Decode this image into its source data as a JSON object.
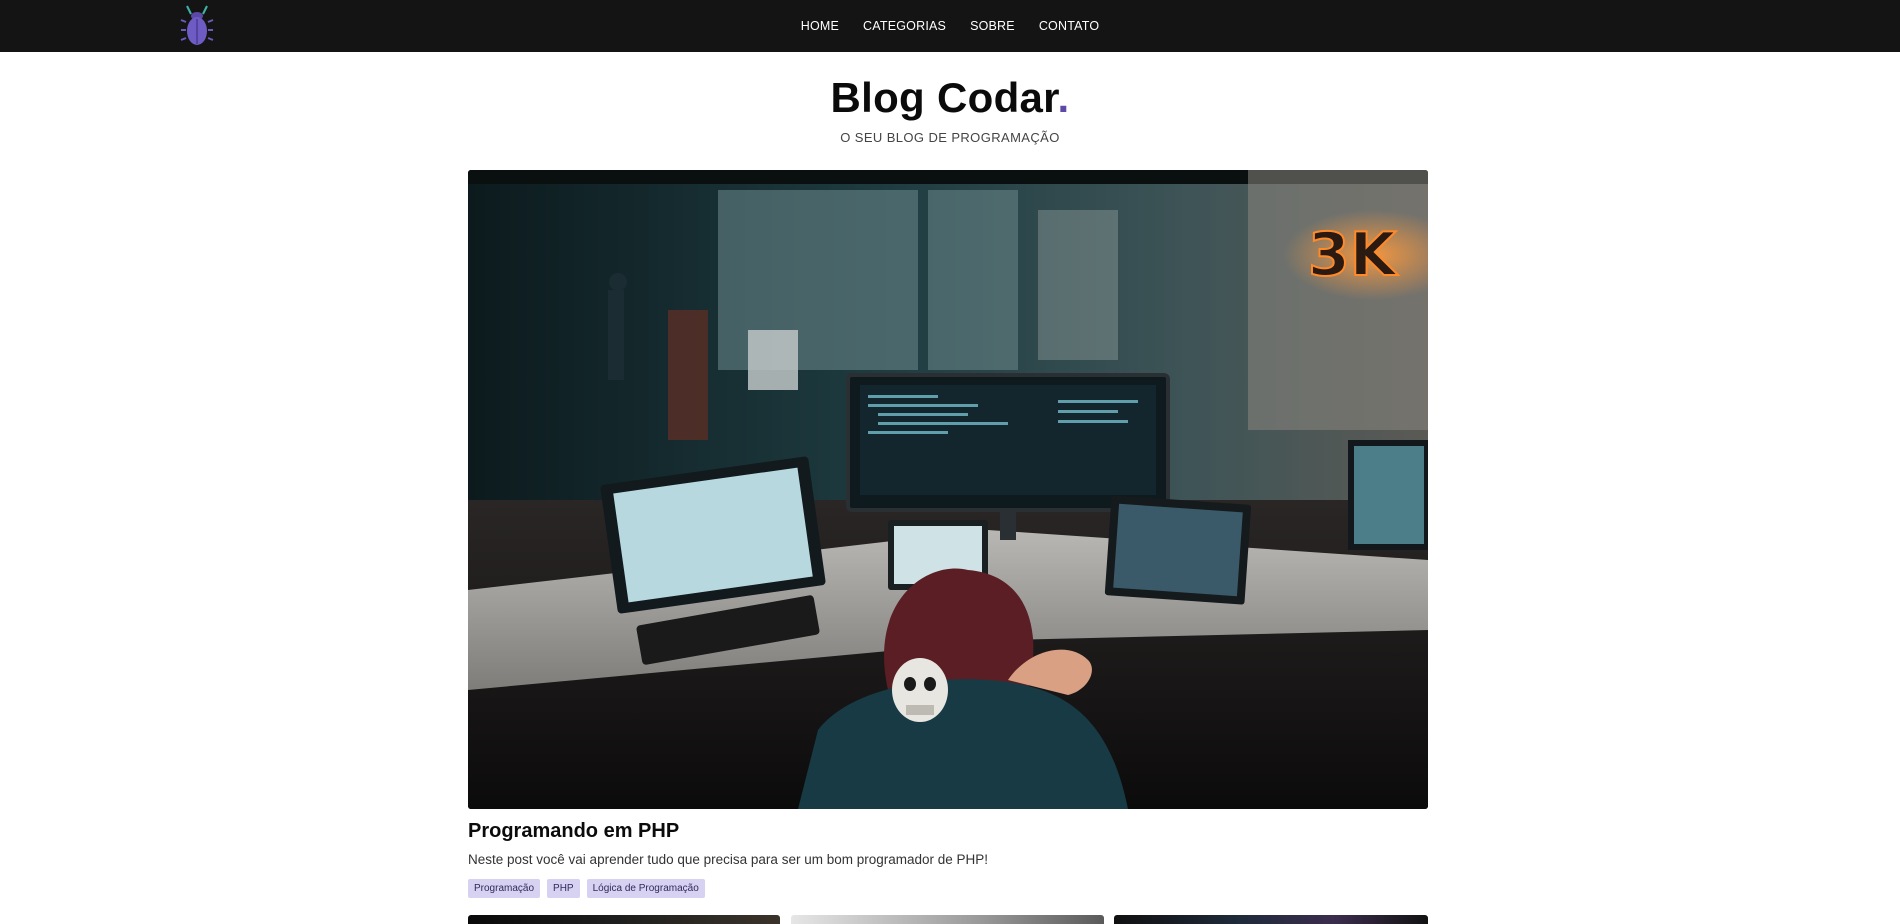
{
  "header": {
    "nav": [
      {
        "label": "HOME"
      },
      {
        "label": "CATEGORIAS"
      },
      {
        "label": "SOBRE"
      },
      {
        "label": "CONTATO"
      }
    ],
    "logo_icon": "bug-icon"
  },
  "brand": {
    "title": "Blog Codar",
    "dot": ".",
    "subtitle": "O SEU BLOG DE PROGRAMAÇÃO",
    "accent_color": "#5e48a8"
  },
  "featured_post": {
    "title": "Programando em PHP",
    "description": "Neste post você vai aprender tudo que precisa para ser um bom programador de PHP!",
    "tags": [
      "Programação",
      "PHP",
      "Lógica de Programação"
    ]
  },
  "colors": {
    "topbar": "#141414",
    "tag_bg": "#d7d2f2",
    "tag_text": "#2f2a5a"
  }
}
